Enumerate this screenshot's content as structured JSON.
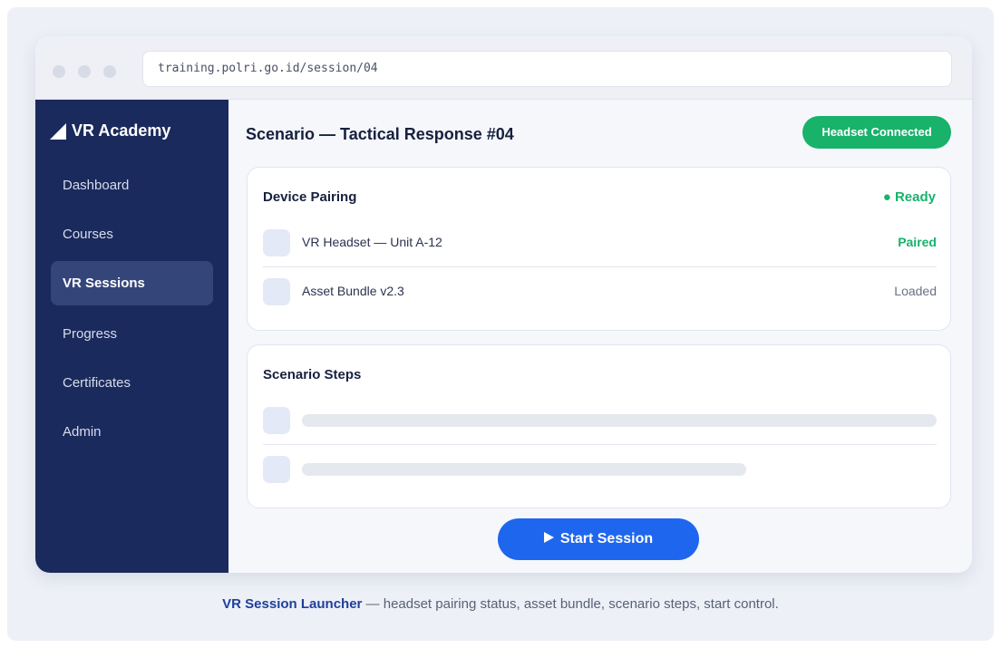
{
  "browser": {
    "url": "training.polri.go.id/session/04"
  },
  "sidebar": {
    "brand": "VR Academy",
    "items": [
      {
        "label": "Dashboard",
        "active": false
      },
      {
        "label": "Courses",
        "active": false
      },
      {
        "label": "VR Sessions",
        "active": true
      },
      {
        "label": "Progress",
        "active": false
      },
      {
        "label": "Certificates",
        "active": false
      },
      {
        "label": "Admin",
        "active": false
      }
    ]
  },
  "header": {
    "title": "Scenario — Tactical Response #04",
    "badge": "Headset Connected"
  },
  "device_pairing": {
    "title": "Device Pairing",
    "status": "● Ready",
    "rows": [
      {
        "label": "VR Headset — Unit A-12",
        "value": "Paired"
      },
      {
        "label": "Asset Bundle v2.3",
        "value": "Loaded"
      }
    ]
  },
  "scenario_steps": {
    "title": "Scenario Steps"
  },
  "actions": {
    "start_label": "Start Session"
  },
  "caption": {
    "strong": "VR Session Launcher",
    "text": " — headset pairing status, asset bundle, scenario steps, start control."
  },
  "colors": {
    "sidebar_bg": "#1b2a5c",
    "accent_blue": "#1f66ef",
    "status_green": "#18b26b"
  }
}
